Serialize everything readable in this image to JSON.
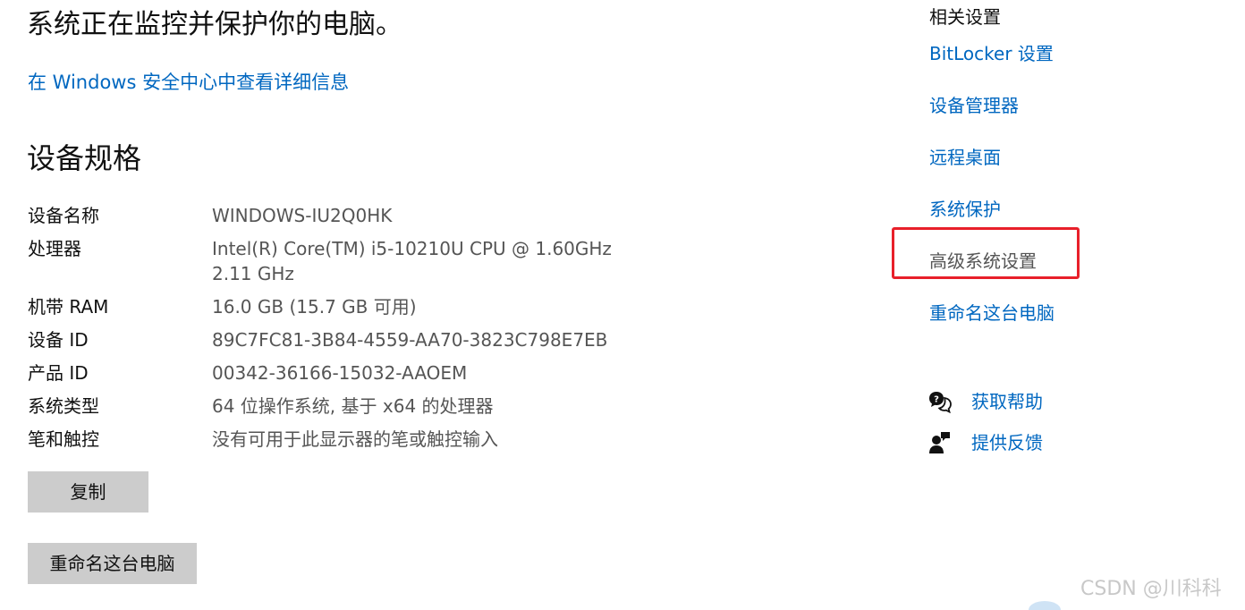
{
  "status": {
    "message": "系统正在监控并保护你的电脑。",
    "security_link": "在 Windows 安全中心中查看详细信息"
  },
  "device_specs": {
    "title": "设备规格",
    "rows": [
      {
        "label": "设备名称",
        "value": "WINDOWS-IU2Q0HK"
      },
      {
        "label": "处理器",
        "value": "Intel(R) Core(TM) i5-10210U CPU @ 1.60GHz   2.11 GHz"
      },
      {
        "label": "机带 RAM",
        "value": "16.0 GB (15.7 GB 可用)"
      },
      {
        "label": "设备 ID",
        "value": "89C7FC81-3B84-4559-AA70-3823C798E7EB"
      },
      {
        "label": "产品 ID",
        "value": "00342-36166-15032-AAOEM"
      },
      {
        "label": "系统类型",
        "value": "64 位操作系统, 基于 x64 的处理器"
      },
      {
        "label": "笔和触控",
        "value": "没有可用于此显示器的笔或触控输入"
      }
    ],
    "copy_button": "复制",
    "rename_button": "重命名这台电脑"
  },
  "related_settings": {
    "title": "相关设置",
    "links": [
      {
        "label": "BitLocker 设置"
      },
      {
        "label": "设备管理器"
      },
      {
        "label": "远程桌面"
      },
      {
        "label": "系统保护"
      },
      {
        "label": "高级系统设置"
      },
      {
        "label": "重命名这台电脑"
      }
    ]
  },
  "help": {
    "items": [
      {
        "label": "获取帮助",
        "icon": "get-help-icon"
      },
      {
        "label": "提供反馈",
        "icon": "feedback-icon"
      }
    ]
  },
  "watermark": "CSDN @川科科",
  "colors": {
    "link": "#0067c0",
    "highlight": "#e8202a",
    "button_bg": "#cccccc"
  }
}
